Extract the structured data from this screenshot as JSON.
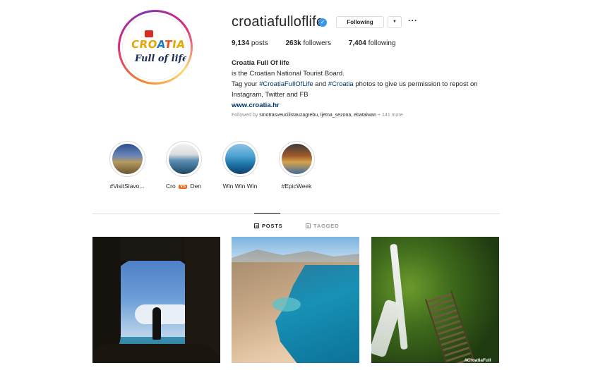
{
  "profile": {
    "username": "croatiafulloflife",
    "avatar_logo_text": [
      "CRO",
      "A",
      "T",
      "IA"
    ],
    "avatar_logo_sub": "Full of life",
    "following_button": "Following",
    "dropdown_glyph": "▼",
    "more_glyph": "···"
  },
  "stats": {
    "posts_count": "9,134",
    "posts_label": "posts",
    "followers_count": "263k",
    "followers_label": "followers",
    "following_count": "7,404",
    "following_label": "following"
  },
  "bio": {
    "name": "Croatia Full Of life",
    "line1": "is the Croatian National Tourist Board.",
    "line2_prefix": "Tag your ",
    "hashtag1": "#CroatiaFullOfLife",
    "line2_mid": " and ",
    "hashtag2": "#Croatia",
    "line2_suffix": " photos to give us permission to repost on",
    "line3": "Instagram, Twitter and FB",
    "website": "www.croatia.hr",
    "followed_by_prefix": "Followed by ",
    "followed_by_users": "smotrasveucilistauzagrebu, ljetna_sezona, ebataiwan",
    "followed_by_suffix": " + 141 more"
  },
  "highlights": [
    {
      "label": "#VisitSlavo..."
    },
    {
      "label_pre": "Cro",
      "label_badge": "VS",
      "label_post": "Den"
    },
    {
      "label": "Win Win Win"
    },
    {
      "label": "#EpicWeek"
    }
  ],
  "tabs": {
    "posts": "POSTS",
    "tagged": "TAGGED"
  },
  "posts": {
    "watermark": "#CroatiaFull"
  },
  "colors": {
    "verified_blue": "#3897f0",
    "link_blue": "#003569",
    "muted_gray": "#8e8e8e",
    "border_gray": "#dbdbdb"
  }
}
